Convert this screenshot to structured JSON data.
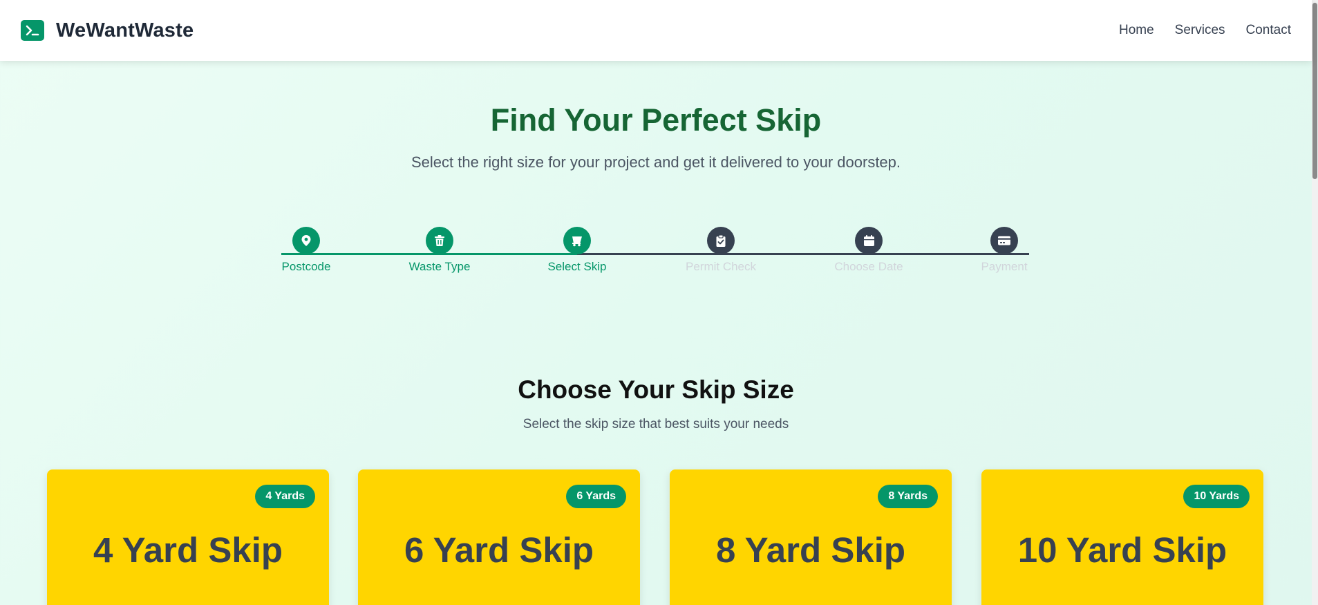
{
  "header": {
    "brand": "WeWantWaste",
    "logo_icon": "terminal-icon",
    "nav": [
      {
        "label": "Home"
      },
      {
        "label": "Services"
      },
      {
        "label": "Contact"
      }
    ]
  },
  "hero": {
    "title": "Find Your Perfect Skip",
    "subtitle": "Select the right size for your project and get it delivered to your doorstep."
  },
  "steps": [
    {
      "label": "Postcode",
      "icon": "map-pin-icon",
      "status": "completed"
    },
    {
      "label": "Waste Type",
      "icon": "trash-icon",
      "status": "completed"
    },
    {
      "label": "Select Skip",
      "icon": "truck-icon",
      "status": "current"
    },
    {
      "label": "Permit Check",
      "icon": "clipboard-check-icon",
      "status": "upcoming"
    },
    {
      "label": "Choose Date",
      "icon": "calendar-icon",
      "status": "upcoming"
    },
    {
      "label": "Payment",
      "icon": "credit-card-icon",
      "status": "upcoming"
    }
  ],
  "section": {
    "title": "Choose Your Skip Size",
    "subtitle": "Select the skip size that best suits your needs"
  },
  "skips": [
    {
      "badge": "4 Yards",
      "title": "4 Yard Skip"
    },
    {
      "badge": "6 Yards",
      "title": "6 Yard Skip"
    },
    {
      "badge": "8 Yards",
      "title": "8 Yard Skip"
    },
    {
      "badge": "10 Yards",
      "title": "10 Yard Skip"
    }
  ],
  "colors": {
    "accent": "#059669",
    "heading_green": "#166534",
    "card_yellow": "#ffd500",
    "step_inactive": "#374151"
  }
}
